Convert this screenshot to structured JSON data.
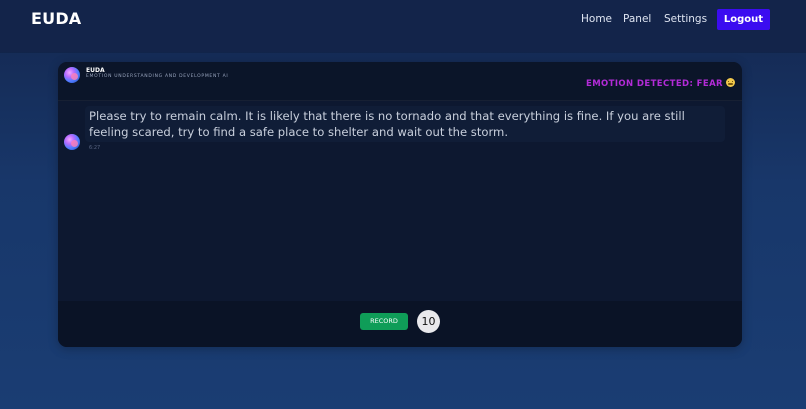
{
  "navbar": {
    "brand": "EUDA",
    "links": [
      "Home",
      "Panel",
      "Settings"
    ],
    "logout_label": "Logout"
  },
  "chat": {
    "bot_name": "EUDA",
    "bot_subtitle": "EMOTION UNDERSTANDING AND DEVELOPMENT AI",
    "emotion_status": "EMOTION DETECTED: FEAR",
    "emotion_icon": "fearful-face-emoji",
    "messages": [
      {
        "sender": "EUDA",
        "text": "Please try to remain calm. It is likely that there is no tornado and that everything is fine. If you are still feeling scared, try to find a safe place to shelter and wait out the storm.",
        "time": "6:27"
      }
    ]
  },
  "controls": {
    "record_label": "RECORD",
    "timer_value": "10"
  },
  "colors": {
    "brand_accent": "#3b0cf0",
    "emotion": "#b32bd8",
    "record": "#0f9d58"
  }
}
